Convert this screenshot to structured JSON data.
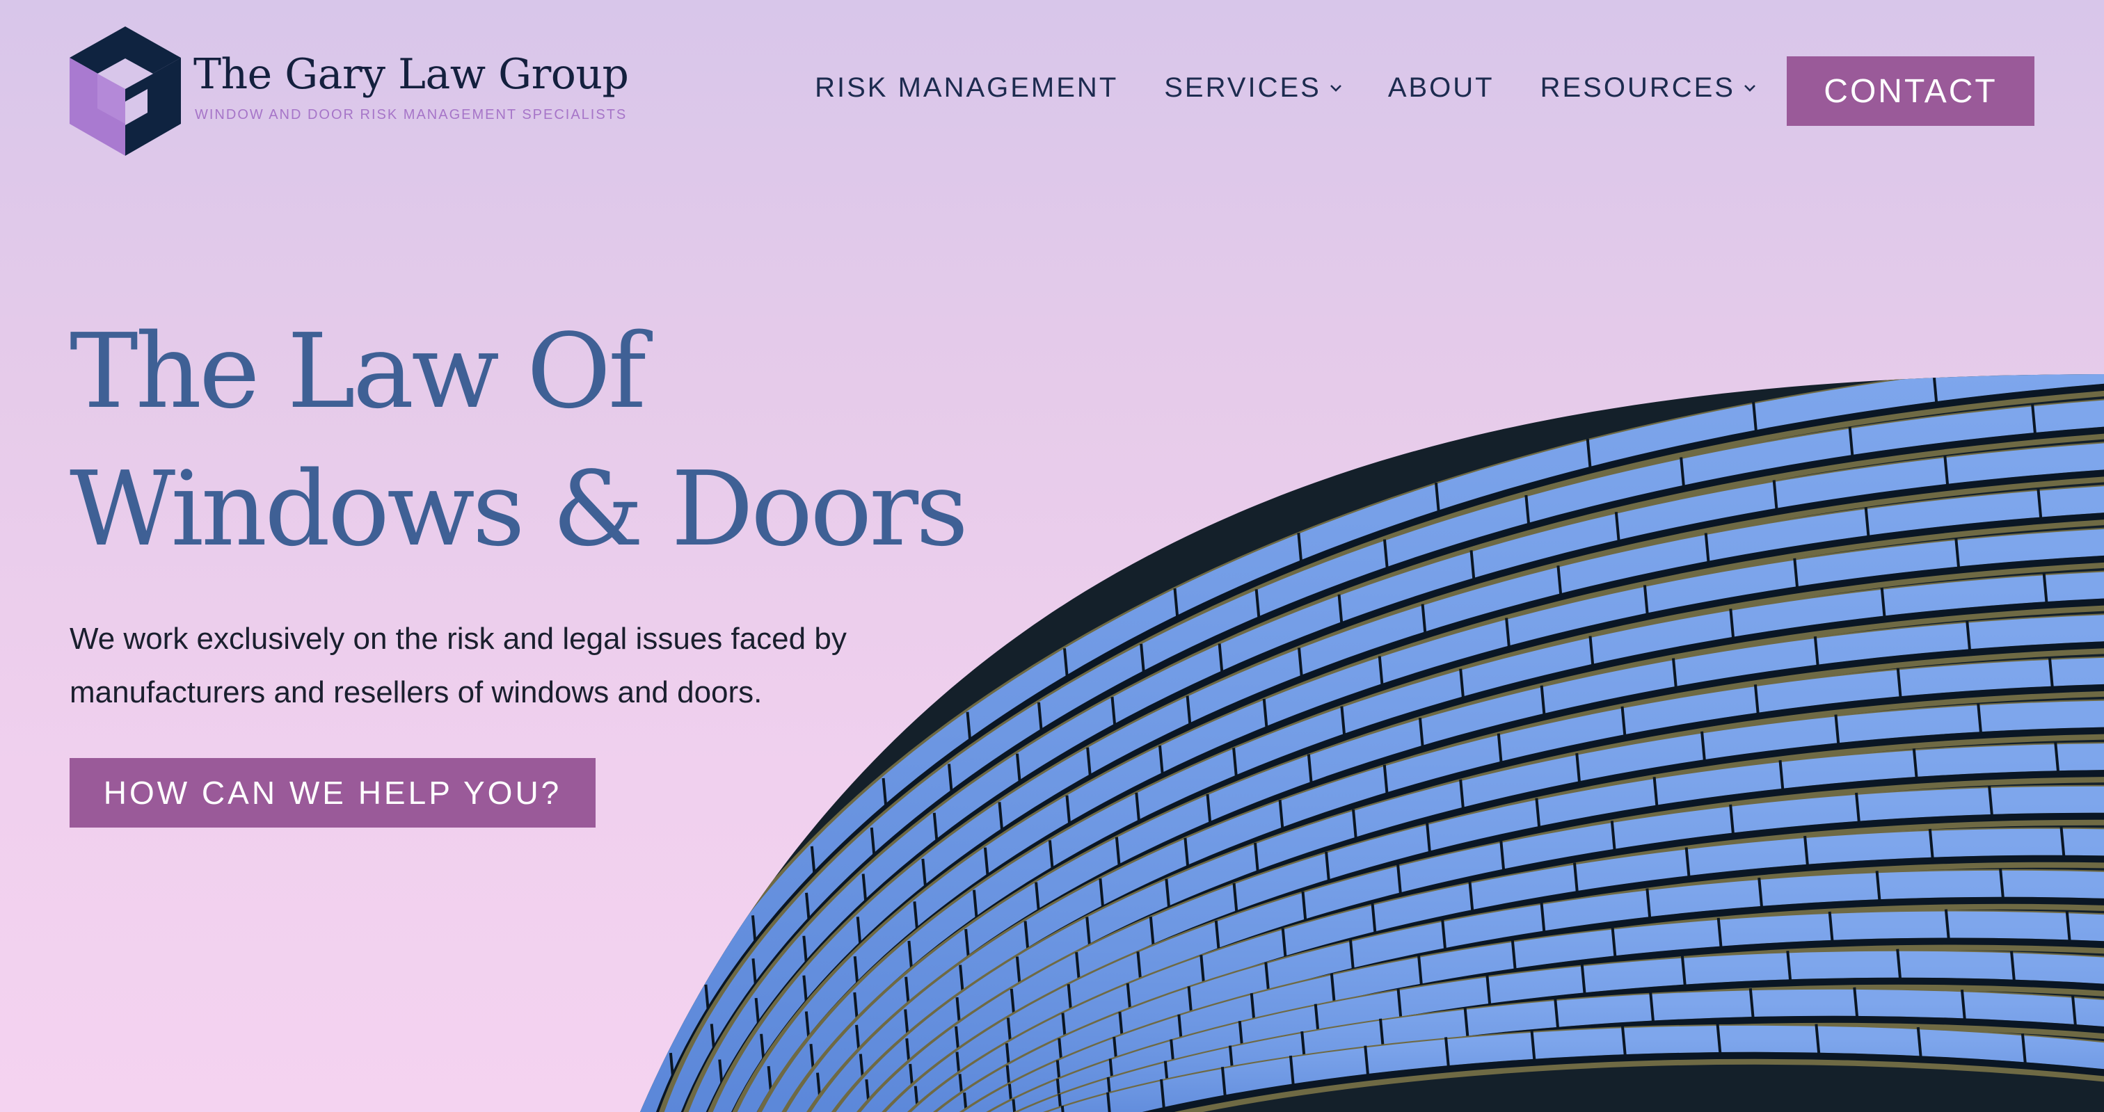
{
  "header": {
    "logo": {
      "name": "The Gary Law Group",
      "tagline": "WINDOW AND DOOR RISK MANAGEMENT SPECIALISTS",
      "colors": {
        "dark": "#0f2340",
        "purple": "#a97ad0"
      }
    },
    "nav": {
      "items": [
        {
          "label": "RISK MANAGEMENT",
          "has_dropdown": false
        },
        {
          "label": "SERVICES",
          "has_dropdown": true
        },
        {
          "label": "ABOUT",
          "has_dropdown": false
        },
        {
          "label": "RESOURCES",
          "has_dropdown": true
        }
      ],
      "contact_label": "CONTACT"
    }
  },
  "hero": {
    "title_line1": "The Law Of",
    "title_line2": "Windows & Doors",
    "subtitle": "We work exclusively on the risk and legal issues faced by manufacturers and resellers of windows and doors.",
    "cta_label": "HOW CAN WE HELP YOU?",
    "image_description": "curved-glass-building-facade"
  },
  "colors": {
    "accent": "#9a5a99",
    "title": "#3f6095",
    "nav_text": "#1d2b4f",
    "background_top": "#d8c6ea",
    "background_bottom": "#f4d3f0",
    "glass": "#6a96e0",
    "mullion": "#0a1624",
    "spandrel": "#6f6a44"
  }
}
